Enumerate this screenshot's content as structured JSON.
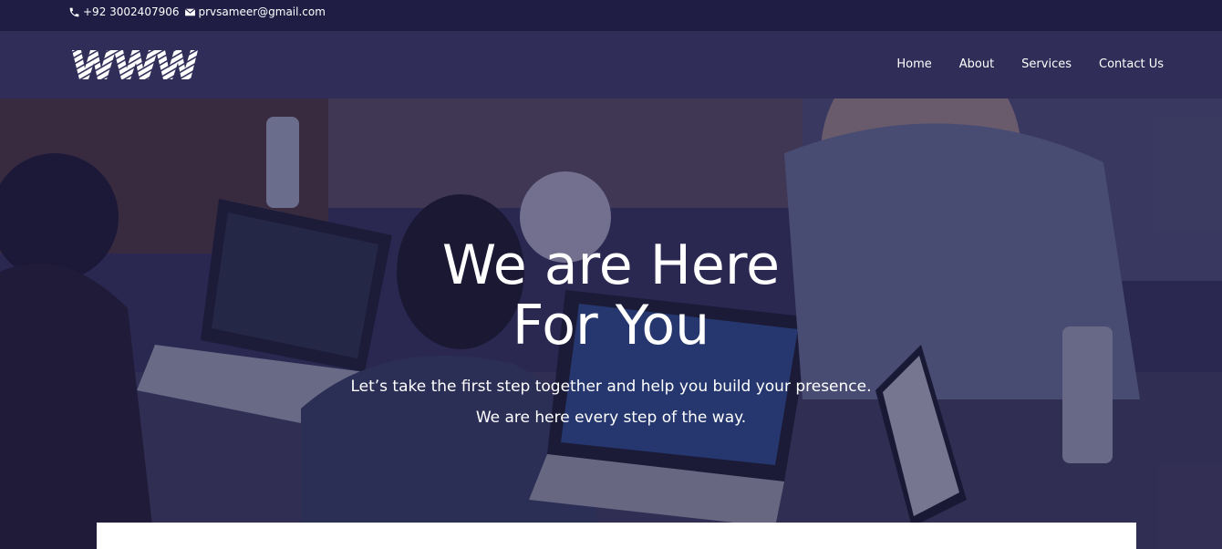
{
  "topbar": {
    "phone": "+92 3002407906",
    "email": "prvsameer@gmail.com",
    "phone_icon": "phone-icon",
    "email_icon": "envelope-icon"
  },
  "header": {
    "logo_text": "WWW",
    "nav": [
      {
        "label": "Home"
      },
      {
        "label": "About"
      },
      {
        "label": "Services"
      },
      {
        "label": "Contact Us"
      }
    ]
  },
  "hero": {
    "title_line1": "We are Here",
    "title_line2": "For You",
    "subtitle_line1": "Let’s take the first step together and help you build your presence.",
    "subtitle_line2": "We are here every step of the way."
  },
  "colors": {
    "topbar_bg": "#1f1d44",
    "header_bg": "#302e58",
    "hero_overlay": "#1e1c46",
    "text": "#ffffff"
  }
}
